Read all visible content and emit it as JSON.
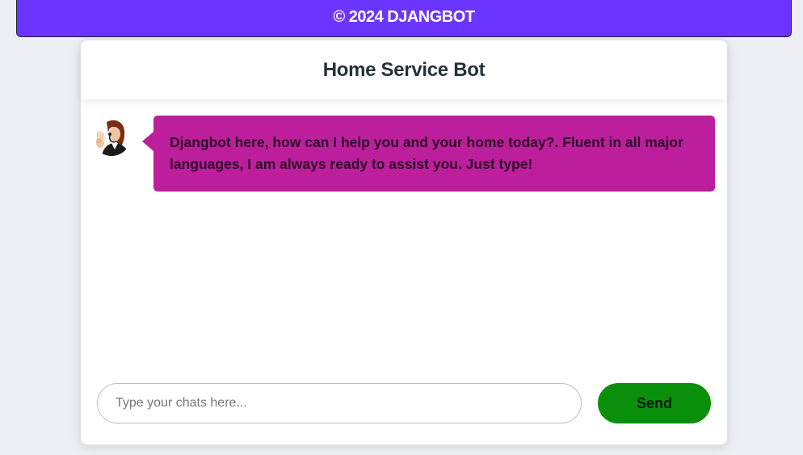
{
  "topbar": {
    "text": "© 2024 DJANGBOT",
    "color": "#6c35ff"
  },
  "chat": {
    "title": "Home Service Bot",
    "messages": [
      {
        "sender": "bot",
        "avatar_icon": "support-agent-avatar",
        "text": "Djangbot here, how can I help you and your home today?. Fluent in all major languages, I am always ready to assist you. Just type!",
        "bubble_color": "#bd1f9c"
      }
    ],
    "input": {
      "placeholder": "Type your chats here...",
      "value": ""
    },
    "send_label": "Send",
    "send_color": "#0a8f0a"
  }
}
